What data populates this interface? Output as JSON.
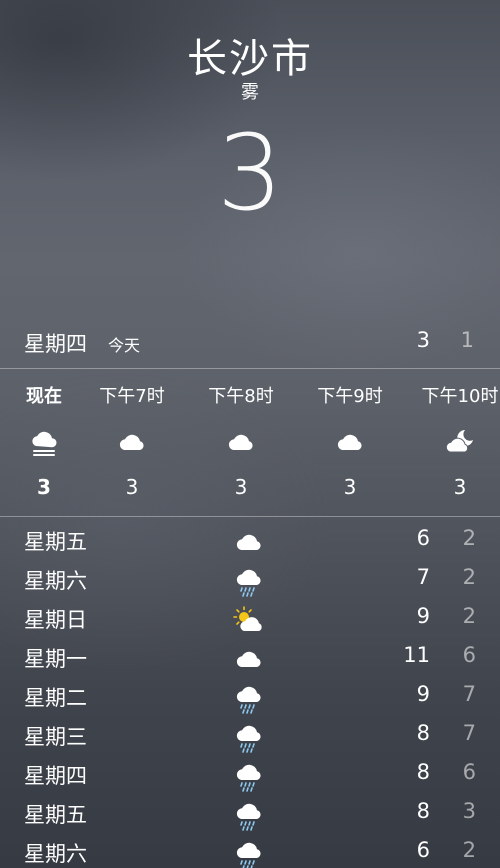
{
  "header": {
    "city": "长沙市",
    "condition": "雾",
    "current_temp": "3"
  },
  "today": {
    "day": "星期四",
    "label": "今天",
    "high": "3",
    "low": "1"
  },
  "hourly": [
    {
      "time": "现在",
      "icon": "fog-icon",
      "temp": "3"
    },
    {
      "time": "下午7时",
      "icon": "cloud-icon",
      "temp": "3"
    },
    {
      "time": "下午8时",
      "icon": "cloud-icon",
      "temp": "3"
    },
    {
      "time": "下午9时",
      "icon": "cloud-icon",
      "temp": "3"
    },
    {
      "time": "下午10时",
      "icon": "partly-cloudy-night-icon",
      "temp": "3"
    }
  ],
  "daily": [
    {
      "day": "星期五",
      "icon": "cloud-icon",
      "high": "6",
      "low": "2"
    },
    {
      "day": "星期六",
      "icon": "rain-icon",
      "high": "7",
      "low": "2"
    },
    {
      "day": "星期日",
      "icon": "partly-sunny-icon",
      "high": "9",
      "low": "2"
    },
    {
      "day": "星期一",
      "icon": "cloud-icon",
      "high": "11",
      "low": "6"
    },
    {
      "day": "星期二",
      "icon": "rain-icon",
      "high": "9",
      "low": "7"
    },
    {
      "day": "星期三",
      "icon": "rain-icon",
      "high": "8",
      "low": "7"
    },
    {
      "day": "星期四",
      "icon": "rain-icon",
      "high": "8",
      "low": "6"
    },
    {
      "day": "星期五",
      "icon": "rain-icon",
      "high": "8",
      "low": "3"
    },
    {
      "day": "星期六",
      "icon": "rain-icon",
      "high": "6",
      "low": "2"
    }
  ],
  "colors": {
    "text": "#ffffff",
    "sun": "#f5c518",
    "rain": "#8ec9f0",
    "secondary_text": "rgba(255,255,255,0.55)"
  }
}
